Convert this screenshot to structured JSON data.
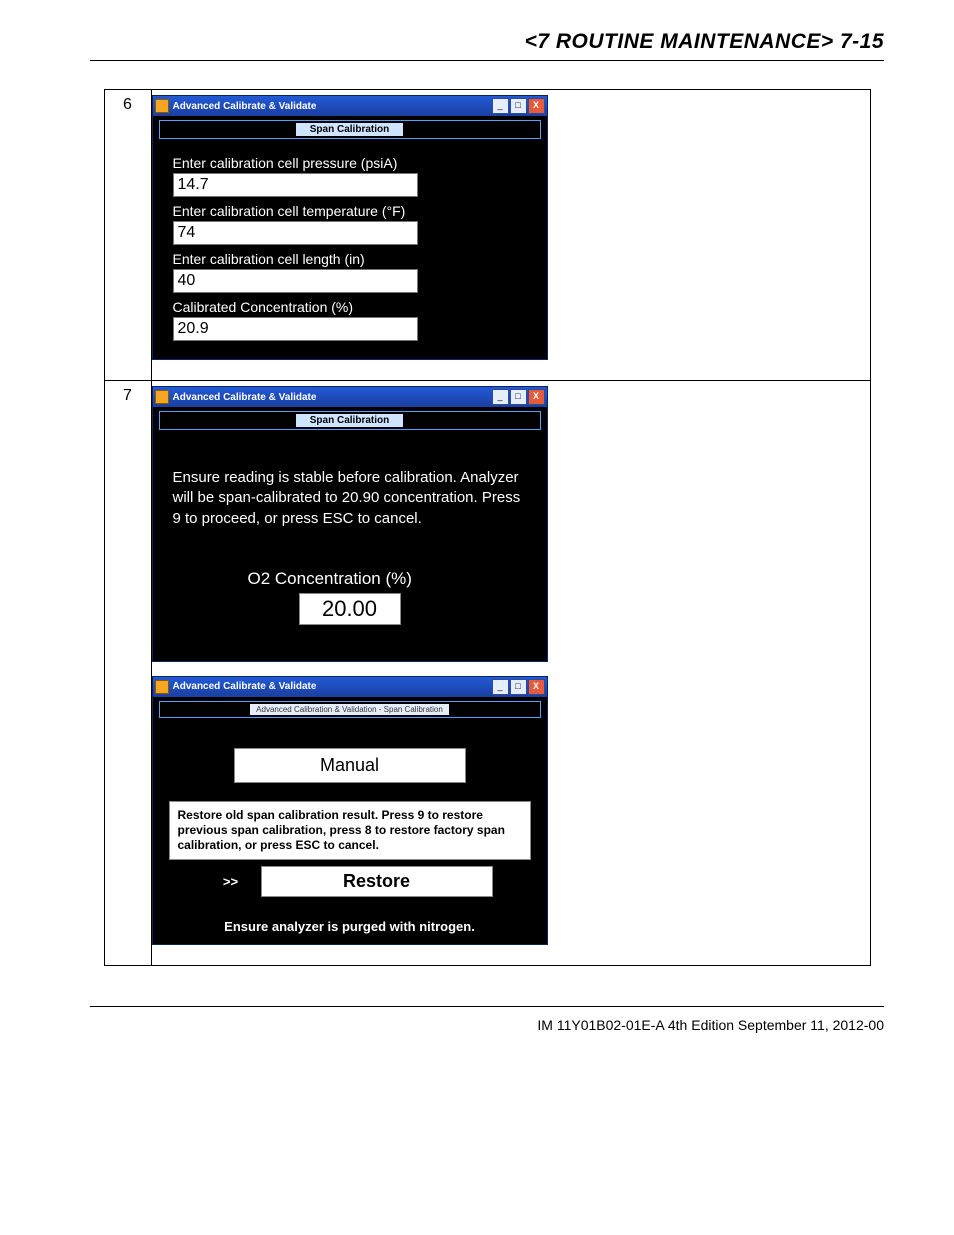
{
  "header": {
    "title": "<7 ROUTINE MAINTENANCE>  7-15"
  },
  "steps": [
    {
      "num": "6",
      "screens": [
        {
          "window_title": "Advanced Calibrate & Validate",
          "subtitle": "Span Calibration",
          "fields": [
            {
              "label": "Enter calibration cell pressure (psiA)",
              "value": "14.7"
            },
            {
              "label": "Enter calibration cell temperature (°F)",
              "value": "74"
            },
            {
              "label": "Enter calibration cell length (in)",
              "value": "40"
            },
            {
              "label": "Calibrated Concentration (%)",
              "value": "20.9"
            }
          ]
        }
      ]
    },
    {
      "num": "7",
      "screens": [
        {
          "window_title": "Advanced Calibrate & Validate",
          "subtitle": "Span Calibration",
          "message": "Ensure reading is stable before calibration. Analyzer will be span-calibrated to 20.90 concentration. Press 9 to proceed, or press ESC to cancel.",
          "o2_label": "O2 Concentration (%)",
          "o2_value": "20.00"
        },
        {
          "window_title": "Advanced Calibrate & Validate",
          "subtitle": "Advanced Calibration & Validation - Span Calibration",
          "manual_button": "Manual",
          "restore_note": "Restore old span calibration result. Press 9 to restore previous span calibration, press 8 to restore factory span calibration, or press ESC to cancel.",
          "arrow": ">>",
          "restore_button": "Restore",
          "purge_msg": "Ensure analyzer is purged with nitrogen."
        }
      ]
    }
  ],
  "footer": {
    "text": "IM 11Y01B02-01E-A  4th Edition September 11, 2012-00"
  },
  "win_ctrl": {
    "min": "_",
    "max": "□",
    "close": "X"
  }
}
